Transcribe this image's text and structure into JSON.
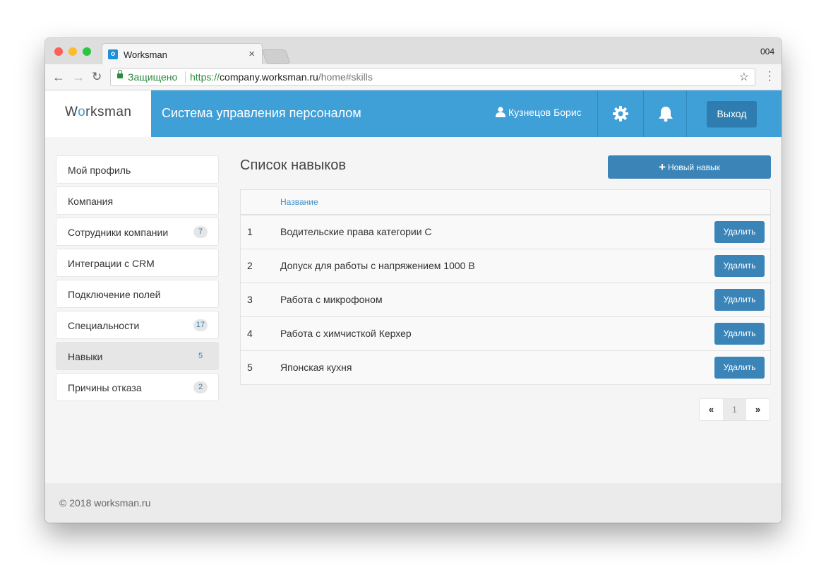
{
  "browser": {
    "tab_title": "Worksman",
    "tab_close": "×",
    "profile_label": "004",
    "secure_label": "Защищено",
    "url_scheme": "https://",
    "url_host": "company.worksman.ru",
    "url_path": "/home#skills"
  },
  "header": {
    "logo_pre": "W",
    "logo_o": "o",
    "logo_post": "rksman",
    "app_title": "Система управления персоналом",
    "user_name": "Кузнецов Борис",
    "logout_label": "Выход"
  },
  "sidebar": {
    "items": [
      {
        "label": "Мой профиль",
        "badge": null
      },
      {
        "label": "Компания",
        "badge": null
      },
      {
        "label": "Сотрудники компании",
        "badge": "7"
      },
      {
        "label": "Интеграции с CRM",
        "badge": null
      },
      {
        "label": "Подключение полей",
        "badge": null
      },
      {
        "label": "Специальности",
        "badge": "17"
      },
      {
        "label": "Навыки",
        "badge": "5"
      },
      {
        "label": "Причины отказа",
        "badge": "2"
      }
    ],
    "active_index": 6
  },
  "main": {
    "title": "Список навыков",
    "new_button_label": "Новый навык",
    "table": {
      "column_name": "Название",
      "rows": [
        {
          "num": "1",
          "name": "Водительские права категории С",
          "action": "Удалить"
        },
        {
          "num": "2",
          "name": "Допуск для работы с напряжением 1000 В",
          "action": "Удалить"
        },
        {
          "num": "3",
          "name": "Работа с микрофоном",
          "action": "Удалить"
        },
        {
          "num": "4",
          "name": "Работа с химчисткой Керхер",
          "action": "Удалить"
        },
        {
          "num": "5",
          "name": "Японская кухня",
          "action": "Удалить"
        }
      ]
    },
    "pagination": {
      "prev": "«",
      "current": "1",
      "next": "»"
    }
  },
  "footer": {
    "copyright": "© 2018 worksman.ru"
  },
  "colors": {
    "brand_blue": "#3f9fd7",
    "button_blue": "#3a84b8",
    "secure_green": "#2a8a3b"
  }
}
